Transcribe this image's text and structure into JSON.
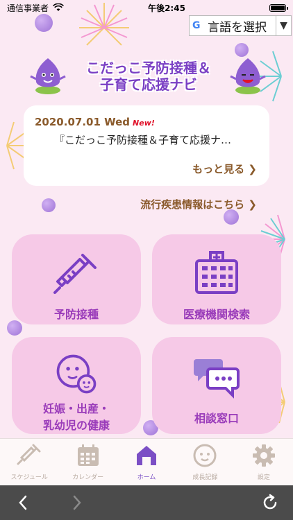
{
  "status_bar": {
    "carrier": "通信事業者",
    "time": "午後2:45"
  },
  "language": {
    "google_mark": "G",
    "label": "言語を選択"
  },
  "header": {
    "title_line1": "こだっこ予防接種＆",
    "title_line2": "子育て応援ナビ"
  },
  "news": {
    "date": "2020.07.01 Wed",
    "badge": "New!",
    "text": "『こだっこ予防接種＆子育て応援ナ…",
    "more_label": "もっと見る"
  },
  "epidemic_link": "流行疾患情報はこちら",
  "tiles": [
    {
      "label": "予防接種",
      "icon": "syringe-icon"
    },
    {
      "label": "医療機関検索",
      "icon": "hospital-icon"
    },
    {
      "label_line1": "妊娠・出産・",
      "label_line2": "乳幼児の健康",
      "icon": "mother-child-icon"
    },
    {
      "label": "相談窓口",
      "icon": "chat-bubbles-icon"
    }
  ],
  "tabs": [
    {
      "label": "スケジュール",
      "icon": "syringe-icon",
      "active": false
    },
    {
      "label": "カレンダー",
      "icon": "calendar-icon",
      "active": false
    },
    {
      "label": "ホーム",
      "icon": "home-icon",
      "active": true
    },
    {
      "label": "成長記録",
      "icon": "baby-face-icon",
      "active": false
    },
    {
      "label": "設定",
      "icon": "gear-icon",
      "active": false
    }
  ],
  "colors": {
    "accent_purple": "#7a3fc4",
    "tile_pink": "#f6c9e7",
    "link_brown": "#8a5a2b",
    "new_red": "#e0122a"
  }
}
